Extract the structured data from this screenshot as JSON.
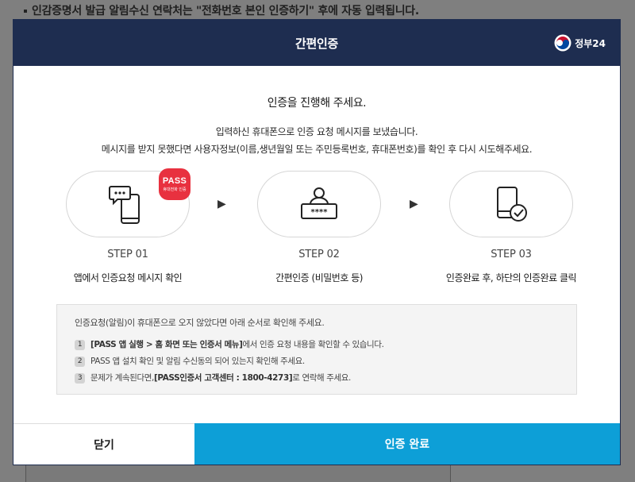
{
  "background": {
    "notice": "인감증명서 발급 알림수신 연락처는 \"전화번호 본인 인증하기\" 후에 자동 입력됩니다."
  },
  "modal": {
    "title": "간편인증",
    "logo_text": "정부24",
    "headline": "인증을 진행해 주세요.",
    "subtext_line1": "입력하신 휴대폰으로 인증 요청 메시지를 보냈습니다.",
    "subtext_line2": "메시지를 받지 못했다면 사용자정보(이름,생년월일 또는 주민등록번호, 휴대폰번호)를 확인 후 다시 시도해주세요.",
    "steps": [
      {
        "label": "STEP 01",
        "desc": "앱에서 인증요청 메시지 확인",
        "icon": "phone-message-icon",
        "badge": "PASS",
        "badge_sub": "휴대전화 인증"
      },
      {
        "label": "STEP 02",
        "desc": "간편인증 (비밀번호 등)",
        "icon": "user-password-icon"
      },
      {
        "label": "STEP 03",
        "desc": "인증완료 후, 하단의 인증완료 클릭",
        "icon": "phone-check-icon"
      }
    ],
    "arrow": "▶",
    "info": {
      "title": "인증요청(알림)이 휴대폰으로 오지 않았다면 아래 순서로 확인해 주세요.",
      "items": [
        {
          "num": "1",
          "bold": "[PASS 앱 실행 > 홈 화면 또는 인증서 메뉴]",
          "text": " 에서 인증 요청 내용을 확인할 수 있습니다."
        },
        {
          "num": "2",
          "bold": "",
          "text": "PASS 앱 설치 확인 및 알림 수신동의 되어 있는지 확인해 주세요."
        },
        {
          "num": "3",
          "pre": "문제가 계속된다면, ",
          "bold": "[PASS인증서 고객센터 : 1800-4273]",
          "text": " 로 연락해 주세요."
        }
      ]
    },
    "buttons": {
      "close": "닫기",
      "done": "인증 완료"
    }
  },
  "colors": {
    "header": "#1e2d50",
    "accent": "#0d9fd7",
    "pass_badge": "#e8313f"
  }
}
